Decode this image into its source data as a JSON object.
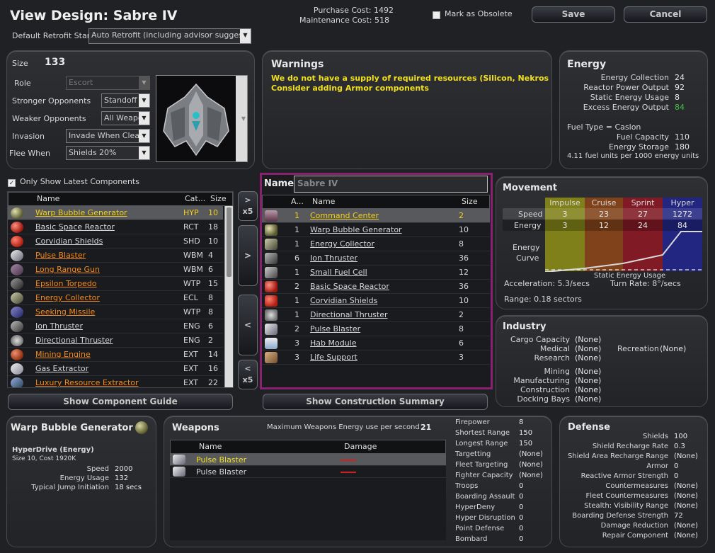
{
  "header": {
    "title": "View Design: Sabre IV",
    "purchase_cost": "Purchase Cost: 1492",
    "maintenance_cost": "Maintenance Cost: 518",
    "obsolete_label": "Mark as Obsolete",
    "save_label": "Save",
    "cancel_label": "Cancel",
    "retrofit_label": "Default Retrofit Stance",
    "retrofit_value": "Auto Retrofit (including advisor suggestions)"
  },
  "settings": {
    "size_label": "Size",
    "size_value": "133",
    "role_label": "Role",
    "role_value": "Escort",
    "stronger_label": "Stronger Opponents",
    "stronger_value": "Standoff",
    "weaker_label": "Weaker Opponents",
    "weaker_value": "All Weapo",
    "invasion_label": "Invasion",
    "invasion_value": "Invade When Clear",
    "flee_label": "Flee When",
    "flee_value": "Shields 20%"
  },
  "warnings": {
    "title": "Warnings",
    "line1": "We do not have a supply of required resources (Silicon, Nekros Stone",
    "line2": "Consider adding Armor components"
  },
  "energy": {
    "title": "Energy",
    "collection_label": "Energy Collection",
    "collection_value": "24",
    "reactor_label": "Reactor Power Output",
    "reactor_value": "92",
    "static_label": "Static Energy Usage",
    "static_value": "8",
    "excess_label": "Excess Energy Output",
    "excess_value": "84",
    "fueltype": "Fuel Type = Caslon",
    "fuelcap_label": "Fuel Capacity",
    "fuelcap_value": "110",
    "storage_label": "Energy Storage",
    "storage_value": "180",
    "fuel_units": "4.11 fuel units per 1000 energy units",
    "excess_color": "#40c040"
  },
  "components": {
    "only_latest_label": "Only Show Latest Components",
    "col_name": "Name",
    "col_cat": "Cat...",
    "col_size": "Size",
    "items": [
      {
        "name": "Warp Bubble Generator",
        "cat": "HYP",
        "size": "10",
        "color": "#f0d020",
        "selected": true,
        "icon": "sphere-icon"
      },
      {
        "name": "Basic Space Reactor",
        "cat": "RCT",
        "size": "18",
        "color": "#d8d8d8",
        "icon": "reactor-icon"
      },
      {
        "name": "Corvidian Shields",
        "cat": "SHD",
        "size": "10",
        "color": "#d8d8d8",
        "icon": "shield-icon"
      },
      {
        "name": "Pulse Blaster",
        "cat": "WBM",
        "size": "4",
        "color": "#f08a20",
        "icon": "blaster-icon"
      },
      {
        "name": "Long Range Gun",
        "cat": "WBM",
        "size": "6",
        "color": "#f08a20",
        "icon": "gun-icon"
      },
      {
        "name": "Epsilon Torpedo",
        "cat": "WTP",
        "size": "15",
        "color": "#f08a20",
        "icon": "torpedo-icon"
      },
      {
        "name": "Energy Collector",
        "cat": "ECL",
        "size": "8",
        "color": "#f08a20",
        "icon": "collector-icon"
      },
      {
        "name": "Seeking Missile",
        "cat": "WTP",
        "size": "8",
        "color": "#f08a20",
        "icon": "missile-icon"
      },
      {
        "name": "Ion Thruster",
        "cat": "ENG",
        "size": "6",
        "color": "#d8d8d8",
        "icon": "thruster-icon"
      },
      {
        "name": "Directional Thruster",
        "cat": "ENG",
        "size": "2",
        "color": "#d8d8d8",
        "icon": "dir-thruster-icon"
      },
      {
        "name": "Mining Engine",
        "cat": "EXT",
        "size": "14",
        "color": "#f08a20",
        "icon": "mining-icon"
      },
      {
        "name": "Gas Extractor",
        "cat": "EXT",
        "size": "16",
        "color": "#d8d8d8",
        "icon": "extractor-icon"
      },
      {
        "name": "Luxury Resource Extractor",
        "cat": "EXT",
        "size": "22",
        "color": "#f08a20",
        "icon": "lux-extractor-icon"
      }
    ],
    "guide_label": "Show Component Guide"
  },
  "transfer": {
    "add_x5": "> x5",
    "add": ">",
    "remove": "<",
    "remove_x5": "< x5"
  },
  "design": {
    "name_label": "Name",
    "name_value": "Sabre IV",
    "col_amount": "A...",
    "col_name": "Name",
    "col_size": "Size",
    "items": [
      {
        "amount": "1",
        "name": "Command Center",
        "size": "2",
        "selected": true,
        "icon": "command-icon"
      },
      {
        "amount": "1",
        "name": "Warp Bubble Generator",
        "size": "10",
        "icon": "sphere-icon"
      },
      {
        "amount": "1",
        "name": "Energy Collector",
        "size": "8",
        "icon": "collector-icon"
      },
      {
        "amount": "6",
        "name": "Ion Thruster",
        "size": "36",
        "icon": "thruster-icon"
      },
      {
        "amount": "1",
        "name": "Small Fuel Cell",
        "size": "12",
        "icon": "fuel-cell-icon"
      },
      {
        "amount": "2",
        "name": "Basic Space Reactor",
        "size": "36",
        "icon": "reactor-icon"
      },
      {
        "amount": "1",
        "name": "Corvidian Shields",
        "size": "10",
        "icon": "shield-icon"
      },
      {
        "amount": "1",
        "name": "Directional Thruster",
        "size": "2",
        "icon": "dir-thruster-icon"
      },
      {
        "amount": "2",
        "name": "Pulse Blaster",
        "size": "8",
        "icon": "blaster-icon"
      },
      {
        "amount": "3",
        "name": "Hab Module",
        "size": "6",
        "icon": "hab-icon"
      },
      {
        "amount": "3",
        "name": "Life Support",
        "size": "3",
        "icon": "life-support-icon"
      }
    ],
    "summary_label": "Show Construction Summary"
  },
  "movement": {
    "title": "Movement",
    "columns": [
      "Impulse",
      "Cruise",
      "Sprint",
      "Hyper"
    ],
    "speed_label": "Speed",
    "speed_values": [
      "3",
      "23",
      "27",
      "1272"
    ],
    "energy_label": "Energy",
    "energy_values": [
      "3",
      "12",
      "24",
      "84"
    ],
    "curve_label_1": "Energy",
    "curve_label_2": "Curve",
    "static_usage": "Static Energy Usage",
    "acceleration": "Acceleration: 5.3/secs",
    "turn_rate": "Turn Rate: 8°/secs",
    "range": "Range: 0.18 sectors"
  },
  "industry": {
    "title": "Industry",
    "cargo_label": "Cargo Capacity",
    "cargo_value": "(None)",
    "medical_label": "Medical",
    "medical_value": "(None)",
    "research_label": "Research",
    "research_value": "(None)",
    "recreation_label": "Recreation",
    "recreation_value": "(None)",
    "mining_label": "Mining",
    "mining_value": "(None)",
    "manufacturing_label": "Manufacturing",
    "manufacturing_value": "(None)",
    "construction_label": "Construction",
    "construction_value": "(None)",
    "docking_label": "Docking Bays",
    "docking_value": "(None)"
  },
  "component_detail": {
    "title": "Warp Bubble Generator",
    "subtitle": "HyperDrive (Energy)",
    "size_cost": "Size 10, Cost 1920K",
    "speed_label": "Speed",
    "speed_value": "2000",
    "energy_label": "Energy Usage",
    "energy_value": "132",
    "jump_label": "Typical Jump Initiation",
    "jump_value": "18 secs"
  },
  "weapons": {
    "title": "Weapons",
    "max_energy_label": "Maximum Weapons Energy use per second",
    "max_energy_value": "21",
    "col_name": "Name",
    "col_damage": "Damage",
    "rows": [
      {
        "name": "Pulse Blaster",
        "selected": true
      },
      {
        "name": "Pulse Blaster",
        "selected": false
      }
    ],
    "stats": [
      {
        "label": "Firepower",
        "value": "8"
      },
      {
        "label": "Shortest Range",
        "value": "150"
      },
      {
        "label": "Longest Range",
        "value": "150"
      },
      {
        "label": "Targetting",
        "value": "(None)"
      },
      {
        "label": "Fleet Targeting",
        "value": "(None)"
      },
      {
        "label": "Fighter Capacity",
        "value": "(None)"
      },
      {
        "label": "Troops",
        "value": "0"
      },
      {
        "label": "Boarding Assault",
        "value": "0"
      },
      {
        "label": "HyperDeny",
        "value": "0"
      },
      {
        "label": "Hyper Disruption",
        "value": "0"
      },
      {
        "label": "Point Defense",
        "value": "0"
      },
      {
        "label": "Bombard",
        "value": "0"
      }
    ]
  },
  "defense": {
    "title": "Defense",
    "stats": [
      {
        "label": "Shields",
        "value": "100"
      },
      {
        "label": "Shield Recharge Rate",
        "value": "0.3"
      },
      {
        "label": "Shield Area Recharge Range",
        "value": "(None)"
      },
      {
        "label": "Armor",
        "value": "0"
      },
      {
        "label": "Reactive Armor Strength",
        "value": "0"
      },
      {
        "label": "Countermeasures",
        "value": "(None)"
      },
      {
        "label": "Fleet Countermeasures",
        "value": "(None)"
      },
      {
        "label": "Stealth: Visibility Range",
        "value": "(None)"
      },
      {
        "label": "Boarding Defense Strength",
        "value": "72"
      },
      {
        "label": "Damage Reduction",
        "value": "(None)"
      },
      {
        "label": "Repair Component",
        "value": "(None)"
      }
    ]
  }
}
